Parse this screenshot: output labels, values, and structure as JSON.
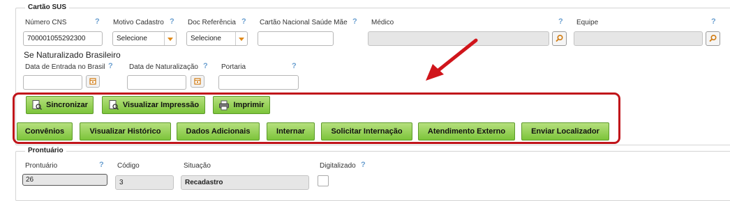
{
  "cartao_sus": {
    "legend": "Cartão SUS",
    "numero_cns": {
      "label": "Número CNS",
      "value": "700001055292300",
      "help": "?"
    },
    "motivo_cadastro": {
      "label": "Motivo Cadastro",
      "value": "Selecione",
      "help": "?"
    },
    "doc_referencia": {
      "label": "Doc Referência",
      "value": "Selecione",
      "help": "?"
    },
    "cartao_mae": {
      "label": "Cartão Nacional Saúde Mãe",
      "value": "",
      "help": "?"
    },
    "medico": {
      "label": "Médico",
      "value": "",
      "help": "?"
    },
    "equipe": {
      "label": "Equipe",
      "value": "",
      "help": "?"
    },
    "naturalizado": {
      "title": "Se Naturalizado Brasileiro",
      "data_entrada": {
        "label": "Data de Entrada no Brasil",
        "value": "",
        "help": "?"
      },
      "data_naturalizacao": {
        "label": "Data de Naturalização",
        "value": "",
        "help": "?"
      },
      "portaria": {
        "label": "Portaria",
        "value": "",
        "help": "?"
      }
    }
  },
  "toolbar": {
    "sincronizar": "Sincronizar",
    "visualizar_impressao": "Visualizar Impressão",
    "imprimir": "Imprimir"
  },
  "actions": {
    "convenios": "Convênios",
    "visualizar_historico": "Visualizar Histórico",
    "dados_adicionais": "Dados Adicionais",
    "internar": "Internar",
    "solicitar_internacao": "Solicitar Internação",
    "atendimento_externo": "Atendimento Externo",
    "enviar_localizador": "Enviar Localizador"
  },
  "prontuario": {
    "legend": "Prontuário",
    "prontuario": {
      "label": "Prontuário",
      "value": "26",
      "help": "?"
    },
    "codigo": {
      "label": "Código",
      "value": "3"
    },
    "situacao": {
      "label": "Situação",
      "value": "Recadastro"
    },
    "digitalizado": {
      "label": "Digitalizado",
      "help": "?",
      "checked": false
    }
  },
  "colors": {
    "highlight_border": "#c0141a",
    "arrow": "#d0151b",
    "button_green_top": "#b6e07e",
    "button_green_bottom": "#7cc43a",
    "help_blue": "#6a9fd0"
  },
  "icons": {
    "lookup": "magnifier-icon",
    "calendar": "calendar-icon",
    "sync": "sync-document-icon",
    "preview": "print-preview-icon",
    "print": "printer-icon",
    "dropdown": "chevron-down-icon"
  }
}
